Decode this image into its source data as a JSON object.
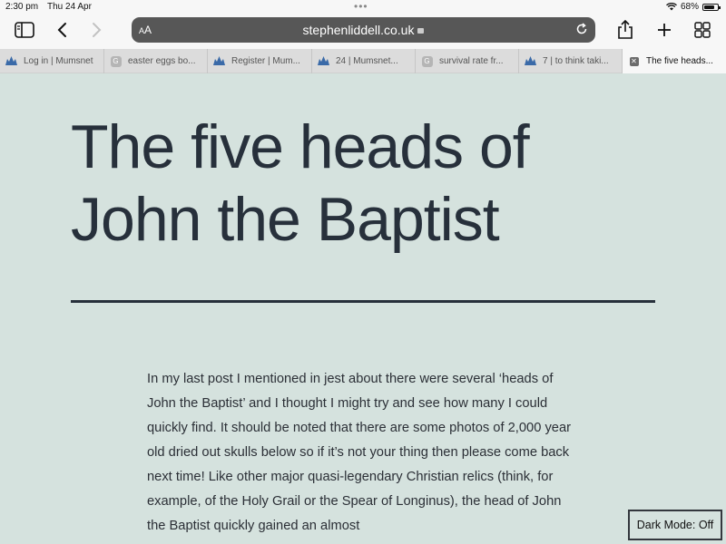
{
  "status": {
    "time": "2:30 pm",
    "date": "Thu 24 Apr",
    "dots": "•••",
    "battery_percent": "68%",
    "battery_level": 0.68
  },
  "toolbar": {
    "text_size_label": "AA",
    "url": "stephenliddell.co.uk"
  },
  "tabs": [
    {
      "icon": "mumsnet-icon",
      "title": "Log in | Mumsnet"
    },
    {
      "icon": "google-icon",
      "title": "easter eggs bo..."
    },
    {
      "icon": "mumsnet-icon",
      "title": "Register | Mum..."
    },
    {
      "icon": "mumsnet-icon",
      "title": "24 | Mumsnet..."
    },
    {
      "icon": "google-icon",
      "title": "survival rate fr..."
    },
    {
      "icon": "mumsnet-icon",
      "title": "7 | to think taki..."
    },
    {
      "icon": "close-icon",
      "title": "The five heads...",
      "active": true
    }
  ],
  "article": {
    "title": "The five heads of John the Baptist",
    "body": "In my last post I mentioned in jest about there were several ‘heads of John the Baptist’ and I thought I might try and see how many I could quickly find. It should be noted that there are some photos of 2,000 year old dried out skulls below so if it’s not your thing then please come back next time! Like other major quasi-legendary Christian relics (think, for example, of the Holy Grail or the Spear of Longinus), the head of John the Baptist quickly gained an almost"
  },
  "dark_mode_label": "Dark Mode: Off",
  "colors": {
    "page_background": "#d5e2de",
    "text": "#27303b",
    "chrome": "#f7f7f7"
  }
}
